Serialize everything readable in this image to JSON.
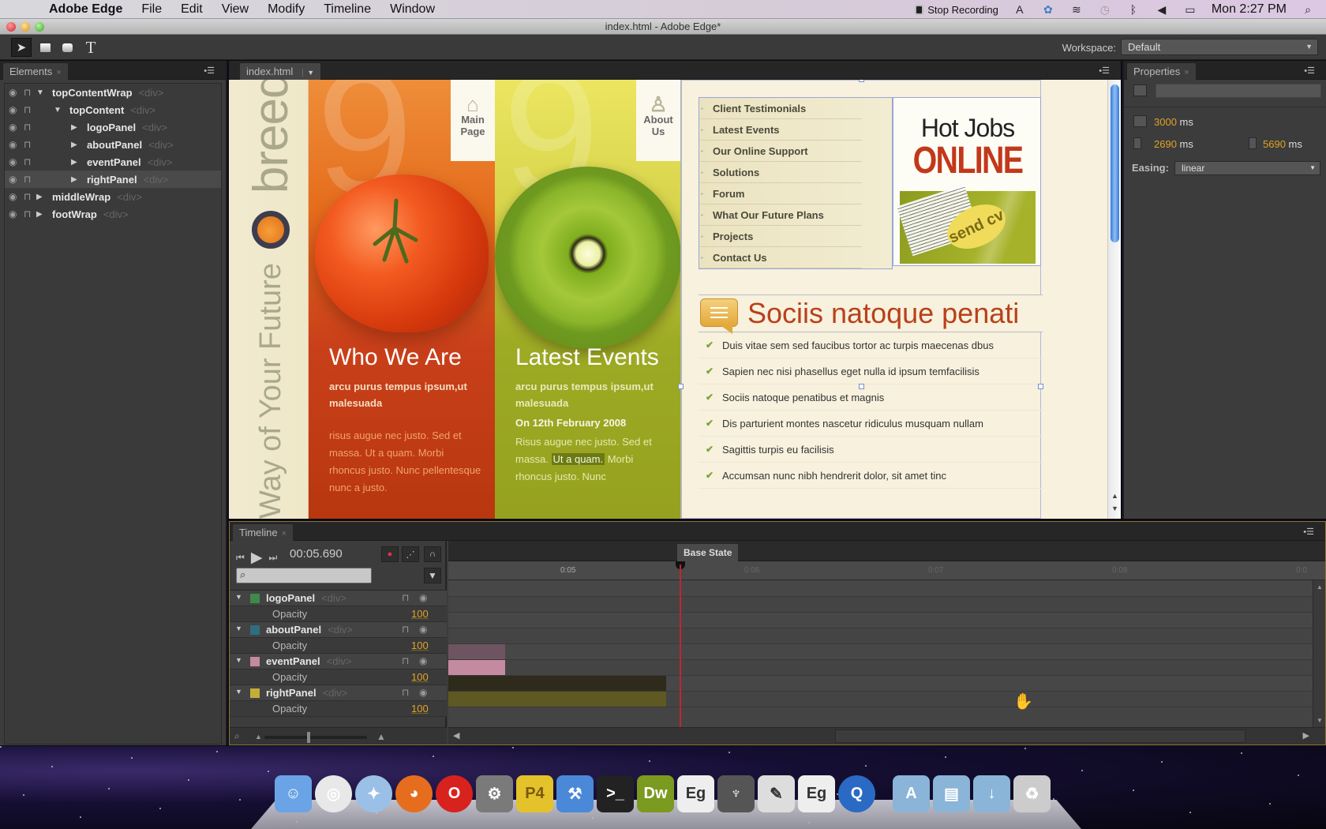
{
  "menubar": {
    "app_name": "Adobe Edge",
    "menus": [
      "File",
      "Edit",
      "View",
      "Modify",
      "Timeline",
      "Window"
    ],
    "recording_label": "Stop Recording",
    "clock": "Mon 2:27 PM"
  },
  "window": {
    "title": "index.html - Adobe Edge*"
  },
  "toolbar": {
    "tools": [
      "selection-tool",
      "rectangle-tool",
      "rounded-rectangle-tool",
      "text-tool"
    ],
    "text_tool_glyph": "T",
    "workspace_label": "Workspace:",
    "workspace_value": "Default"
  },
  "elements_panel": {
    "tab_label": "Elements",
    "items": [
      {
        "name": "topContentWrap",
        "tag": "<div>",
        "depth": 0,
        "expanded": true
      },
      {
        "name": "topContent",
        "tag": "<div>",
        "depth": 1,
        "expanded": true
      },
      {
        "name": "logoPanel",
        "tag": "<div>",
        "depth": 2,
        "expanded": false
      },
      {
        "name": "aboutPanel",
        "tag": "<div>",
        "depth": 2,
        "expanded": false
      },
      {
        "name": "eventPanel",
        "tag": "<div>",
        "depth": 2,
        "expanded": false
      },
      {
        "name": "rightPanel",
        "tag": "<div>",
        "depth": 2,
        "expanded": false,
        "selected": true
      },
      {
        "name": "middleWrap",
        "tag": "<div>",
        "depth": 0,
        "expanded": false
      },
      {
        "name": "footWrap",
        "tag": "<div>",
        "depth": 0,
        "expanded": false
      }
    ]
  },
  "document": {
    "tab_label": "index.html",
    "site": {
      "brand": "breed",
      "tagline": "Way of Your Future",
      "about": {
        "nav_label_line1": "Main",
        "nav_label_line2": "Page",
        "heading": "Who We Are",
        "sub": "arcu purus tempus ipsum,ut malesuada",
        "body": "risus augue nec justo. Sed et massa. Ut a quam. Morbi rhoncus justo. Nunc pellentesque nunc a justo."
      },
      "event": {
        "nav_label_line1": "About",
        "nav_label_line2": "Us",
        "heading": "Latest Events",
        "sub": "arcu purus tempus ipsum,ut malesuada",
        "date": "On 12th February 2008",
        "body_before": "Risus augue nec justo. Sed et massa. ",
        "body_highlight": "Ut a quam.",
        "body_after": " Morbi rhoncus justo. Nunc"
      },
      "nav_links": [
        "Client Testimonials",
        "Latest Events",
        "Our Online Support",
        "Solutions",
        "Forum",
        "What Our Future Plans",
        "Projects",
        "Contact Us"
      ],
      "jobs_banner": {
        "line1": "Hot Jobs",
        "line2": "ONLINE",
        "bubble": "send cv"
      },
      "section_title": "Sociis natoque penati",
      "checklist": [
        "Duis vitae sem sed faucibus tortor ac turpis maecenas dbus",
        "Sapien nec nisi phasellus eget nulla id ipsum temfacilisis",
        "Sociis natoque penatibus et magnis",
        "Dis parturient montes nascetur ridiculus musquam nullam",
        "Sagittis turpis eu facilisis",
        "Accumsan nunc nibh hendrerit dolor, sit amet tinc"
      ]
    }
  },
  "properties": {
    "tab_label": "Properties",
    "duration_value": "3000",
    "start_value": "2690",
    "end_value": "5690",
    "unit": "ms",
    "easing_label": "Easing:",
    "easing_value": "linear"
  },
  "timeline": {
    "tab_label": "Timeline",
    "current_time": "00:05.690",
    "state_label": "Base State",
    "ticks": [
      "0:05",
      "0:06",
      "0:07",
      "0:08",
      "0:0"
    ],
    "tracks": [
      {
        "name": "logoPanel",
        "tag": "<div>",
        "color": "#3f8a4a",
        "property": "Opacity",
        "value": "100"
      },
      {
        "name": "aboutPanel",
        "tag": "<div>",
        "color": "#2f6e7e",
        "property": "Opacity",
        "value": "100"
      },
      {
        "name": "eventPanel",
        "tag": "<div>",
        "color": "#c48aa0",
        "property": "Opacity",
        "value": "100"
      },
      {
        "name": "rightPanel",
        "tag": "<div>",
        "color": "#c4ae3a",
        "property": "Opacity",
        "value": "100"
      }
    ]
  },
  "dock": {
    "apps": [
      "Finder",
      "Chrome",
      "Safari",
      "Firefox",
      "Opera",
      "System Preferences",
      "P4",
      "Xcode",
      "Terminal",
      "Dreamweaver",
      "Edge",
      "Instruments",
      "Preview",
      "Edge",
      "QuickTime",
      "Applications",
      "Documents",
      "Downloads",
      "Trash"
    ]
  }
}
